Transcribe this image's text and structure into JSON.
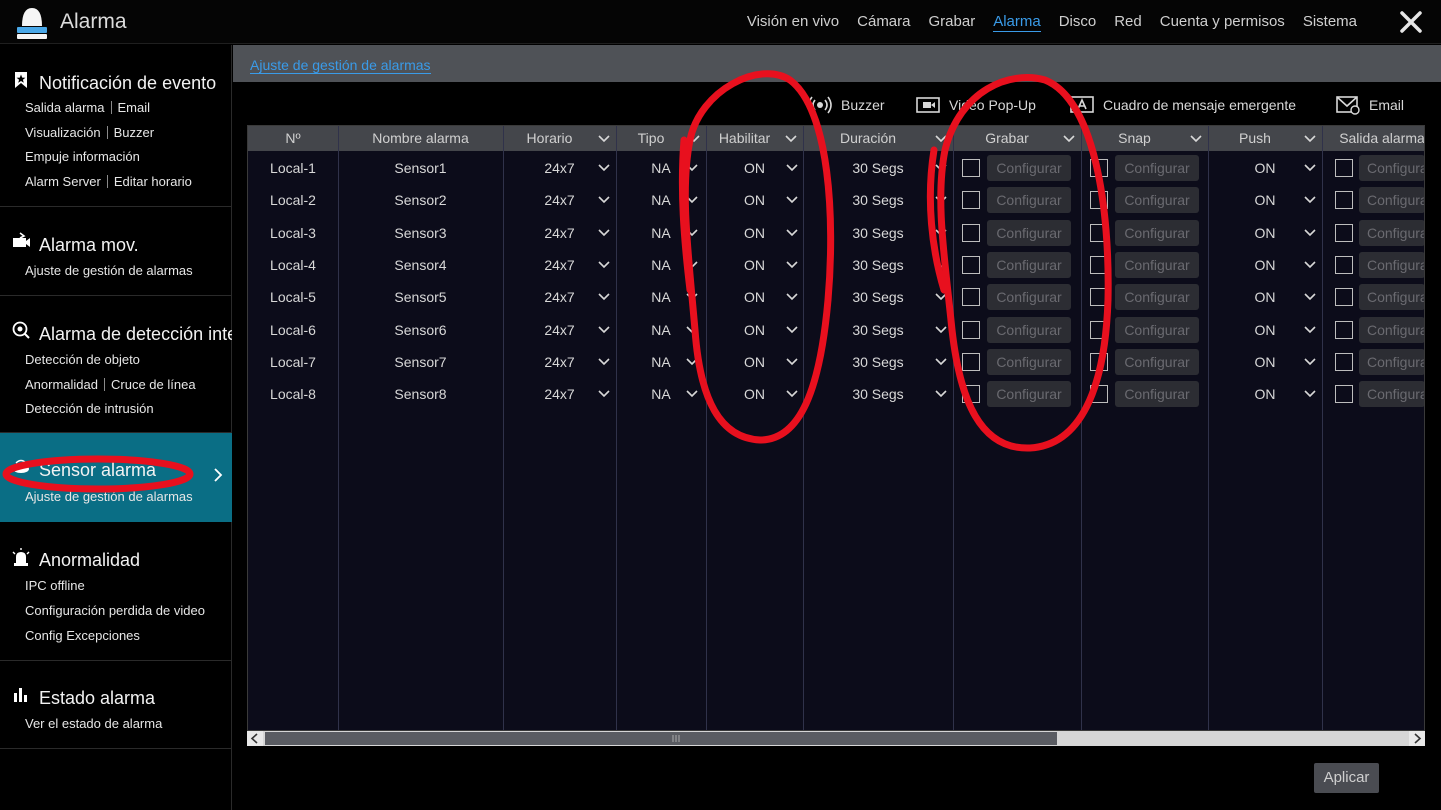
{
  "app": {
    "title": "Alarma"
  },
  "topnav": [
    {
      "label": "Visión en vivo",
      "active": false
    },
    {
      "label": "Cámara",
      "active": false
    },
    {
      "label": "Grabar",
      "active": false
    },
    {
      "label": "Alarma",
      "active": true
    },
    {
      "label": "Disco",
      "active": false
    },
    {
      "label": "Red",
      "active": false
    },
    {
      "label": "Cuenta y permisos",
      "active": false
    },
    {
      "label": "Sistema",
      "active": false
    }
  ],
  "sidebar": {
    "groups": [
      {
        "title": "Notificación de evento",
        "icon": "bookmark-star-icon",
        "rows": [
          [
            "Salida alarma",
            "Email"
          ],
          [
            "Visualización",
            "Buzzer"
          ],
          [
            "Empuje información"
          ],
          [
            "Alarm Server",
            "Editar horario"
          ]
        ]
      },
      {
        "title": "Alarma mov.",
        "icon": "motion-alarm-icon",
        "rows": [
          [
            "Ajuste de gestión de alarmas"
          ]
        ]
      },
      {
        "title": "Alarma de detección inteligente",
        "icon": "smart-detection-icon",
        "rows": [
          [
            "Detección de objeto"
          ],
          [
            "Anormalidad",
            "Cruce de línea"
          ],
          [
            "Detección de intrusión"
          ]
        ]
      },
      {
        "title": "Sensor alarma",
        "icon": "sensor-icon",
        "active": true,
        "rows": [
          [
            "Ajuste de gestión de alarmas"
          ]
        ]
      },
      {
        "title": "Anormalidad",
        "icon": "siren-icon",
        "rows": [
          [
            "IPC offline"
          ],
          [
            "Configuración perdida de video"
          ],
          [
            "Config Excepciones"
          ]
        ]
      },
      {
        "title": "Estado alarma",
        "icon": "status-bars-icon",
        "rows": [
          [
            "Ver el estado de alarma"
          ]
        ]
      }
    ]
  },
  "breadcrumb": "Ajuste de gestión de alarmas",
  "toolbar": [
    {
      "label": "Buzzer",
      "icon": "buzzer-icon"
    },
    {
      "label": "Video Pop-Up",
      "icon": "video-popup-icon"
    },
    {
      "label": "Cuadro de mensaje emergente",
      "icon": "message-box-icon"
    },
    {
      "label": "Email",
      "icon": "email-icon"
    }
  ],
  "table": {
    "headers": [
      "Nº",
      "Nombre alarma",
      "Horario",
      "Tipo",
      "Habilitar",
      "Duración",
      "Grabar",
      "Snap",
      "Push",
      "Salida alarma"
    ],
    "configure_label": "Configurar",
    "rows": [
      {
        "no": "Local-1",
        "name": "Sensor1",
        "schedule": "24x7",
        "type": "NA",
        "enable": "ON",
        "duration": "30 Segs",
        "push": "ON"
      },
      {
        "no": "Local-2",
        "name": "Sensor2",
        "schedule": "24x7",
        "type": "NA",
        "enable": "ON",
        "duration": "30 Segs",
        "push": "ON"
      },
      {
        "no": "Local-3",
        "name": "Sensor3",
        "schedule": "24x7",
        "type": "NA",
        "enable": "ON",
        "duration": "30 Segs",
        "push": "ON"
      },
      {
        "no": "Local-4",
        "name": "Sensor4",
        "schedule": "24x7",
        "type": "NA",
        "enable": "ON",
        "duration": "30 Segs",
        "push": "ON"
      },
      {
        "no": "Local-5",
        "name": "Sensor5",
        "schedule": "24x7",
        "type": "NA",
        "enable": "ON",
        "duration": "30 Segs",
        "push": "ON"
      },
      {
        "no": "Local-6",
        "name": "Sensor6",
        "schedule": "24x7",
        "type": "NA",
        "enable": "ON",
        "duration": "30 Segs",
        "push": "ON"
      },
      {
        "no": "Local-7",
        "name": "Sensor7",
        "schedule": "24x7",
        "type": "NA",
        "enable": "ON",
        "duration": "30 Segs",
        "push": "ON"
      },
      {
        "no": "Local-8",
        "name": "Sensor8",
        "schedule": "24x7",
        "type": "NA",
        "enable": "ON",
        "duration": "30 Segs",
        "push": "ON"
      }
    ]
  },
  "apply_label": "Aplicar",
  "colors": {
    "accent": "#3a9be8",
    "active_sidebar": "#0a6e85",
    "annotation": "#e8101e"
  }
}
